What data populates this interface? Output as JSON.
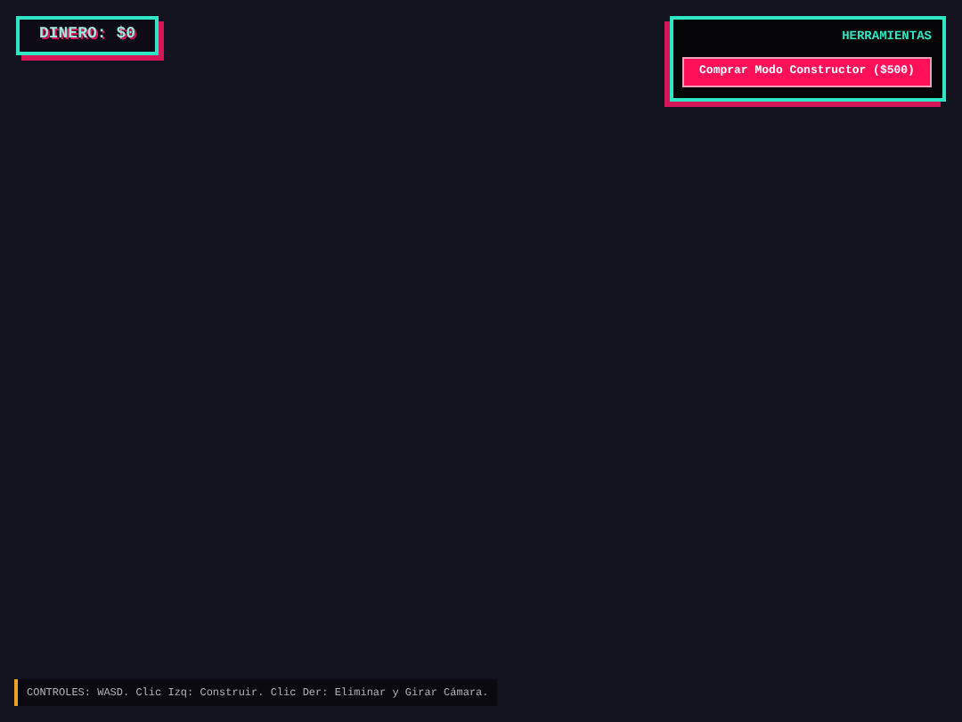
{
  "money": {
    "label": "DINERO: $0"
  },
  "tools": {
    "title": "HERRAMIENTAS",
    "button": "Comprar Modo Constructor ($500)"
  },
  "controls": {
    "text": "CONTROLES: WASD. Clic Izq: Construir. Clic Der: Eliminar y Girar Cámara."
  }
}
